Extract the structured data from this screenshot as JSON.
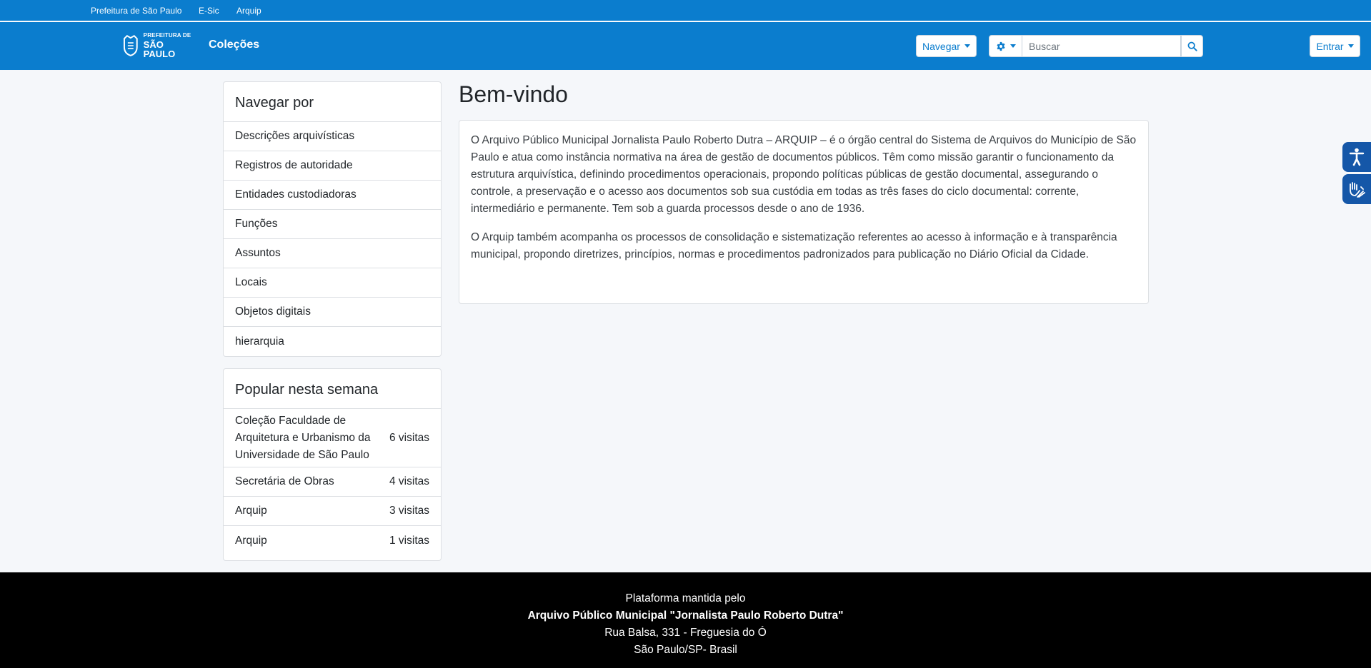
{
  "topbar": {
    "links": [
      "Prefeitura de São Paulo",
      "E-Sic",
      "Arquip"
    ]
  },
  "header": {
    "logo": {
      "line1": "PREFEITURA DE",
      "line2": "SÃO PAULO"
    },
    "brand": "Coleções",
    "navigate_label": "Navegar",
    "search_placeholder": "Buscar",
    "login_label": "Entrar",
    "icons": {
      "settings": "gear-icon",
      "search": "magnifier-icon"
    }
  },
  "browse": {
    "title": "Navegar por",
    "items": [
      "Descrições arquivísticas",
      "Registros de autoridade",
      "Entidades custodiadoras",
      "Funções",
      "Assuntos",
      "Locais",
      "Objetos digitais",
      "hierarquia"
    ]
  },
  "popular": {
    "title": "Popular nesta semana",
    "items": [
      {
        "name": "Coleção Faculdade de Arquitetura e Urbanismo da Universidade de São Paulo",
        "count": "6 visitas"
      },
      {
        "name": "Secretária de Obras",
        "count": "4 visitas"
      },
      {
        "name": "Arquip",
        "count": "3 visitas"
      },
      {
        "name": "Arquip",
        "count": "1 visitas"
      }
    ]
  },
  "main": {
    "title": "Bem-vindo",
    "paragraphs": [
      "O Arquivo Público Municipal Jornalista Paulo Roberto Dutra – ARQUIP – é o órgão central do Sistema de Arquivos do Município de São Paulo e atua como instância normativa na área de gestão de documentos públicos. Têm como missão garantir o funcionamento da estrutura arquivística, definindo procedimentos operacionais, propondo políticas públicas de gestão documental, assegurando o controle, a preservação e o acesso aos documentos sob sua custódia em todas as três fases do ciclo documental: corrente, intermediário e permanente. Tem sob a guarda processos desde o ano de 1936.",
      "O Arquip também acompanha os processos de consolidação e sistematização referentes ao acesso à informação e à transparência municipal, propondo diretrizes, princípios, normas e procedimentos padronizados para publicação no Diário Oficial da Cidade."
    ]
  },
  "accessibility": {
    "icons": [
      "accessibility-icon",
      "sign-language-icon"
    ]
  },
  "footer": {
    "line1": "Plataforma mantida pelo",
    "line2": "Arquivo Público Municipal \"Jornalista Paulo Roberto Dutra\"",
    "line3": "Rua Balsa, 331 - Freguesia do Ó",
    "line4": "São Paulo/SP- Brasil"
  },
  "colors": {
    "primary": "#0b7dce",
    "accessibility": "#1557a8",
    "footer": "#000000"
  }
}
